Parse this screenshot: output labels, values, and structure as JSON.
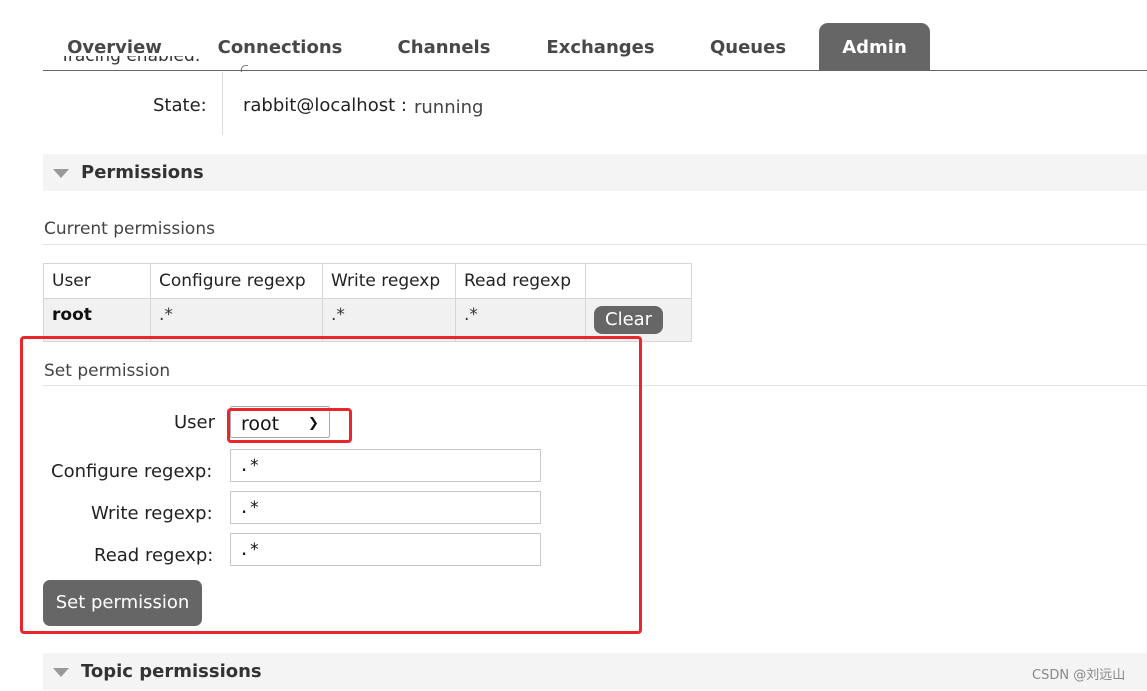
{
  "tabs": [
    {
      "label": "Overview",
      "active": false
    },
    {
      "label": "Connections",
      "active": false
    },
    {
      "label": "Channels",
      "active": false
    },
    {
      "label": "Exchanges",
      "active": false
    },
    {
      "label": "Queues",
      "active": false
    },
    {
      "label": "Admin",
      "active": true
    }
  ],
  "clipped_row": {
    "label": "Tracing enabled:",
    "value": "○"
  },
  "state": {
    "label": "State:",
    "node": "rabbit@localhost :",
    "value": "running"
  },
  "permissions_section": {
    "title": "Permissions"
  },
  "current_permissions": {
    "heading": "Current permissions",
    "columns": [
      "User",
      "Configure regexp",
      "Write regexp",
      "Read regexp",
      ""
    ],
    "rows": [
      {
        "user": "root",
        "configure": ".*",
        "write": ".*",
        "read": ".*",
        "action": "Clear"
      }
    ]
  },
  "set_permission": {
    "heading": "Set permission",
    "user_label": "User",
    "user_selected": "root",
    "configure_label": "Configure regexp:",
    "configure_value": ".*",
    "write_label": "Write regexp:",
    "write_value": ".*",
    "read_label": "Read regexp:",
    "read_value": ".*",
    "submit_label": "Set permission"
  },
  "topic_section": {
    "title": "Topic permissions"
  },
  "watermark": "CSDN @刘远山",
  "colors": {
    "tab_active": "#666666",
    "button": "#666666",
    "annotation": "#e8262b",
    "section_bg": "#f4f4f4"
  }
}
